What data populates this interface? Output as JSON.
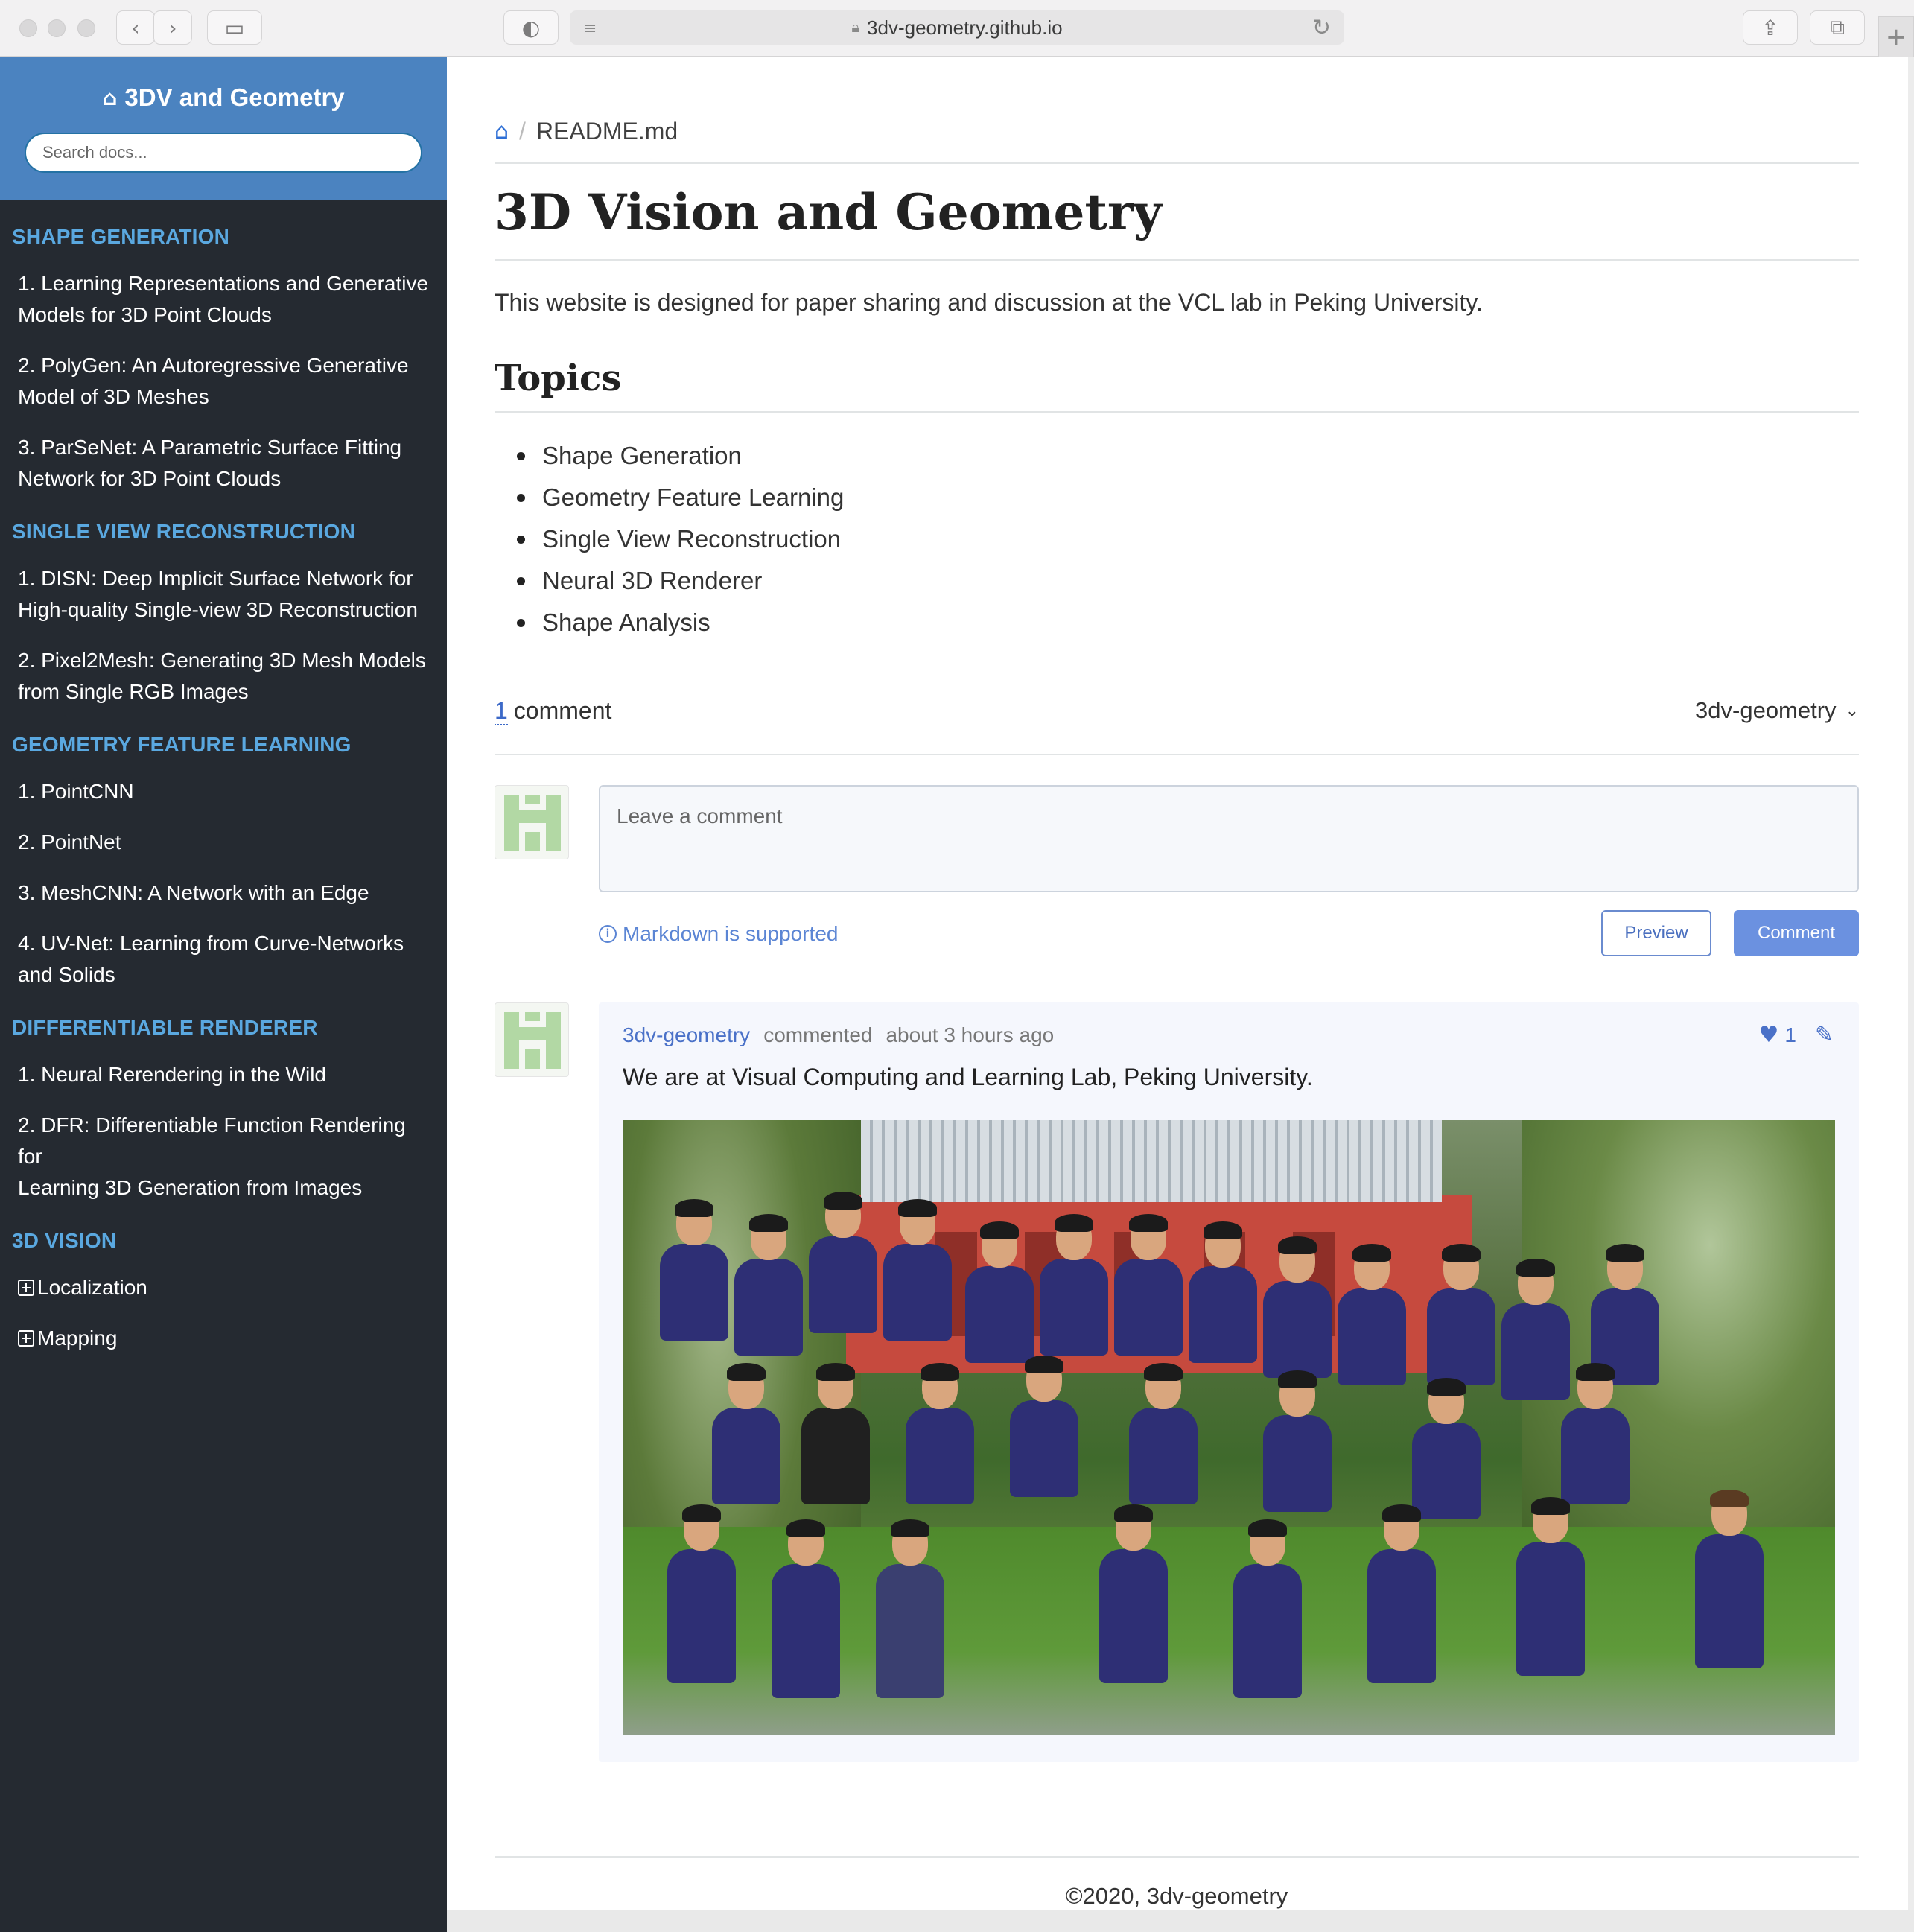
{
  "browser": {
    "url": "3dv-geometry.github.io"
  },
  "sidebar": {
    "brand": "3DV and Geometry",
    "search_placeholder": "Search docs...",
    "sections": [
      {
        "caption": "SHAPE GENERATION",
        "items": [
          [
            "1. Learning Representations and Generative",
            "Models for 3D Point Clouds"
          ],
          [
            "2. PolyGen: An Autoregressive Generative",
            "Model of 3D Meshes"
          ],
          [
            "3. ParSeNet: A Parametric Surface Fitting",
            "Network for 3D Point Clouds"
          ]
        ]
      },
      {
        "caption": "SINGLE VIEW RECONSTRUCTION",
        "items": [
          [
            "1. DISN: Deep Implicit Surface Network for",
            "High-quality Single-view 3D Reconstruction"
          ],
          [
            "2. Pixel2Mesh: Generating 3D Mesh Models",
            "from Single RGB Images"
          ]
        ]
      },
      {
        "caption": "GEOMETRY FEATURE LEARNING",
        "items": [
          [
            "1. PointCNN"
          ],
          [
            "2. PointNet"
          ],
          [
            "3. MeshCNN: A Network with an Edge"
          ],
          [
            "4. UV-Net: Learning from Curve-Networks",
            "and Solids"
          ]
        ]
      },
      {
        "caption": "DIFFERENTIABLE RENDERER",
        "items": [
          [
            "1. Neural Rerendering in the Wild"
          ],
          [
            "2. DFR: Differentiable Function Rendering for",
            "Learning 3D Generation from Images"
          ]
        ]
      },
      {
        "caption": "3D VISION",
        "expandable": [
          "Localization",
          "Mapping"
        ]
      }
    ]
  },
  "main": {
    "breadcrumb": "README.md",
    "title": "3D Vision and Geometry",
    "intro": "This website is designed for paper sharing and discussion at the VCL lab in Peking University.",
    "topics_heading": "Topics",
    "topics": [
      "Shape Generation",
      "Geometry Feature Learning",
      "Single View Reconstruction",
      "Neural 3D Renderer",
      "Shape Analysis"
    ]
  },
  "comments": {
    "count": "1",
    "count_label": "comment",
    "user": "3dv-geometry",
    "placeholder": "Leave a comment",
    "markdown_note": "Markdown is supported",
    "preview_label": "Preview",
    "comment_label": "Comment",
    "item": {
      "author": "3dv-geometry",
      "action": "commented",
      "time": "about 3 hours ago",
      "likes": "1",
      "body": "We are at Visual Computing and Learning Lab, Peking University."
    }
  },
  "footer": "©2020, 3dv-geometry"
}
